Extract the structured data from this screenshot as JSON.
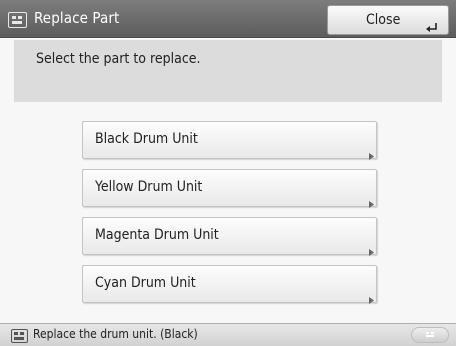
{
  "header": {
    "title": "Replace Part",
    "icon": "replace-part-icon",
    "close_label": "Close"
  },
  "message": {
    "text": "Select the part to replace."
  },
  "parts": [
    {
      "label": "Black Drum Unit"
    },
    {
      "label": "Yellow Drum Unit"
    },
    {
      "label": "Magenta Drum Unit"
    },
    {
      "label": "Cyan Drum Unit"
    }
  ],
  "status": {
    "text": "Replace the drum unit. (Black)",
    "icon": "status-monitor-icon",
    "pill_icon": "status-indicator-icon"
  },
  "colors": {
    "titlebar": "#6e6e6e",
    "message_bg": "#dcdcdc",
    "button_bg": "#f2f2f2"
  }
}
